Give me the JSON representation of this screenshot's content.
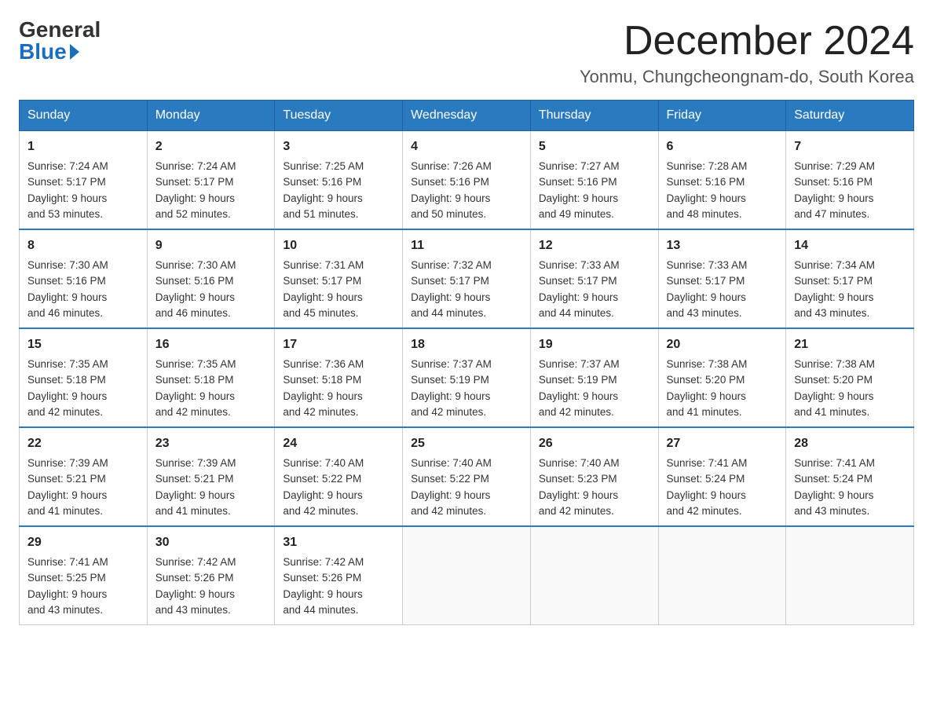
{
  "logo": {
    "general": "General",
    "blue": "Blue"
  },
  "header": {
    "month_year": "December 2024",
    "location": "Yonmu, Chungcheongnam-do, South Korea"
  },
  "days_of_week": [
    "Sunday",
    "Monday",
    "Tuesday",
    "Wednesday",
    "Thursday",
    "Friday",
    "Saturday"
  ],
  "weeks": [
    [
      {
        "day": "1",
        "sunrise": "7:24 AM",
        "sunset": "5:17 PM",
        "daylight": "9 hours and 53 minutes."
      },
      {
        "day": "2",
        "sunrise": "7:24 AM",
        "sunset": "5:17 PM",
        "daylight": "9 hours and 52 minutes."
      },
      {
        "day": "3",
        "sunrise": "7:25 AM",
        "sunset": "5:16 PM",
        "daylight": "9 hours and 51 minutes."
      },
      {
        "day": "4",
        "sunrise": "7:26 AM",
        "sunset": "5:16 PM",
        "daylight": "9 hours and 50 minutes."
      },
      {
        "day": "5",
        "sunrise": "7:27 AM",
        "sunset": "5:16 PM",
        "daylight": "9 hours and 49 minutes."
      },
      {
        "day": "6",
        "sunrise": "7:28 AM",
        "sunset": "5:16 PM",
        "daylight": "9 hours and 48 minutes."
      },
      {
        "day": "7",
        "sunrise": "7:29 AM",
        "sunset": "5:16 PM",
        "daylight": "9 hours and 47 minutes."
      }
    ],
    [
      {
        "day": "8",
        "sunrise": "7:30 AM",
        "sunset": "5:16 PM",
        "daylight": "9 hours and 46 minutes."
      },
      {
        "day": "9",
        "sunrise": "7:30 AM",
        "sunset": "5:16 PM",
        "daylight": "9 hours and 46 minutes."
      },
      {
        "day": "10",
        "sunrise": "7:31 AM",
        "sunset": "5:17 PM",
        "daylight": "9 hours and 45 minutes."
      },
      {
        "day": "11",
        "sunrise": "7:32 AM",
        "sunset": "5:17 PM",
        "daylight": "9 hours and 44 minutes."
      },
      {
        "day": "12",
        "sunrise": "7:33 AM",
        "sunset": "5:17 PM",
        "daylight": "9 hours and 44 minutes."
      },
      {
        "day": "13",
        "sunrise": "7:33 AM",
        "sunset": "5:17 PM",
        "daylight": "9 hours and 43 minutes."
      },
      {
        "day": "14",
        "sunrise": "7:34 AM",
        "sunset": "5:17 PM",
        "daylight": "9 hours and 43 minutes."
      }
    ],
    [
      {
        "day": "15",
        "sunrise": "7:35 AM",
        "sunset": "5:18 PM",
        "daylight": "9 hours and 42 minutes."
      },
      {
        "day": "16",
        "sunrise": "7:35 AM",
        "sunset": "5:18 PM",
        "daylight": "9 hours and 42 minutes."
      },
      {
        "day": "17",
        "sunrise": "7:36 AM",
        "sunset": "5:18 PM",
        "daylight": "9 hours and 42 minutes."
      },
      {
        "day": "18",
        "sunrise": "7:37 AM",
        "sunset": "5:19 PM",
        "daylight": "9 hours and 42 minutes."
      },
      {
        "day": "19",
        "sunrise": "7:37 AM",
        "sunset": "5:19 PM",
        "daylight": "9 hours and 42 minutes."
      },
      {
        "day": "20",
        "sunrise": "7:38 AM",
        "sunset": "5:20 PM",
        "daylight": "9 hours and 41 minutes."
      },
      {
        "day": "21",
        "sunrise": "7:38 AM",
        "sunset": "5:20 PM",
        "daylight": "9 hours and 41 minutes."
      }
    ],
    [
      {
        "day": "22",
        "sunrise": "7:39 AM",
        "sunset": "5:21 PM",
        "daylight": "9 hours and 41 minutes."
      },
      {
        "day": "23",
        "sunrise": "7:39 AM",
        "sunset": "5:21 PM",
        "daylight": "9 hours and 41 minutes."
      },
      {
        "day": "24",
        "sunrise": "7:40 AM",
        "sunset": "5:22 PM",
        "daylight": "9 hours and 42 minutes."
      },
      {
        "day": "25",
        "sunrise": "7:40 AM",
        "sunset": "5:22 PM",
        "daylight": "9 hours and 42 minutes."
      },
      {
        "day": "26",
        "sunrise": "7:40 AM",
        "sunset": "5:23 PM",
        "daylight": "9 hours and 42 minutes."
      },
      {
        "day": "27",
        "sunrise": "7:41 AM",
        "sunset": "5:24 PM",
        "daylight": "9 hours and 42 minutes."
      },
      {
        "day": "28",
        "sunrise": "7:41 AM",
        "sunset": "5:24 PM",
        "daylight": "9 hours and 43 minutes."
      }
    ],
    [
      {
        "day": "29",
        "sunrise": "7:41 AM",
        "sunset": "5:25 PM",
        "daylight": "9 hours and 43 minutes."
      },
      {
        "day": "30",
        "sunrise": "7:42 AM",
        "sunset": "5:26 PM",
        "daylight": "9 hours and 43 minutes."
      },
      {
        "day": "31",
        "sunrise": "7:42 AM",
        "sunset": "5:26 PM",
        "daylight": "9 hours and 44 minutes."
      },
      null,
      null,
      null,
      null
    ]
  ],
  "labels": {
    "sunrise": "Sunrise:",
    "sunset": "Sunset:",
    "daylight": "Daylight:"
  }
}
